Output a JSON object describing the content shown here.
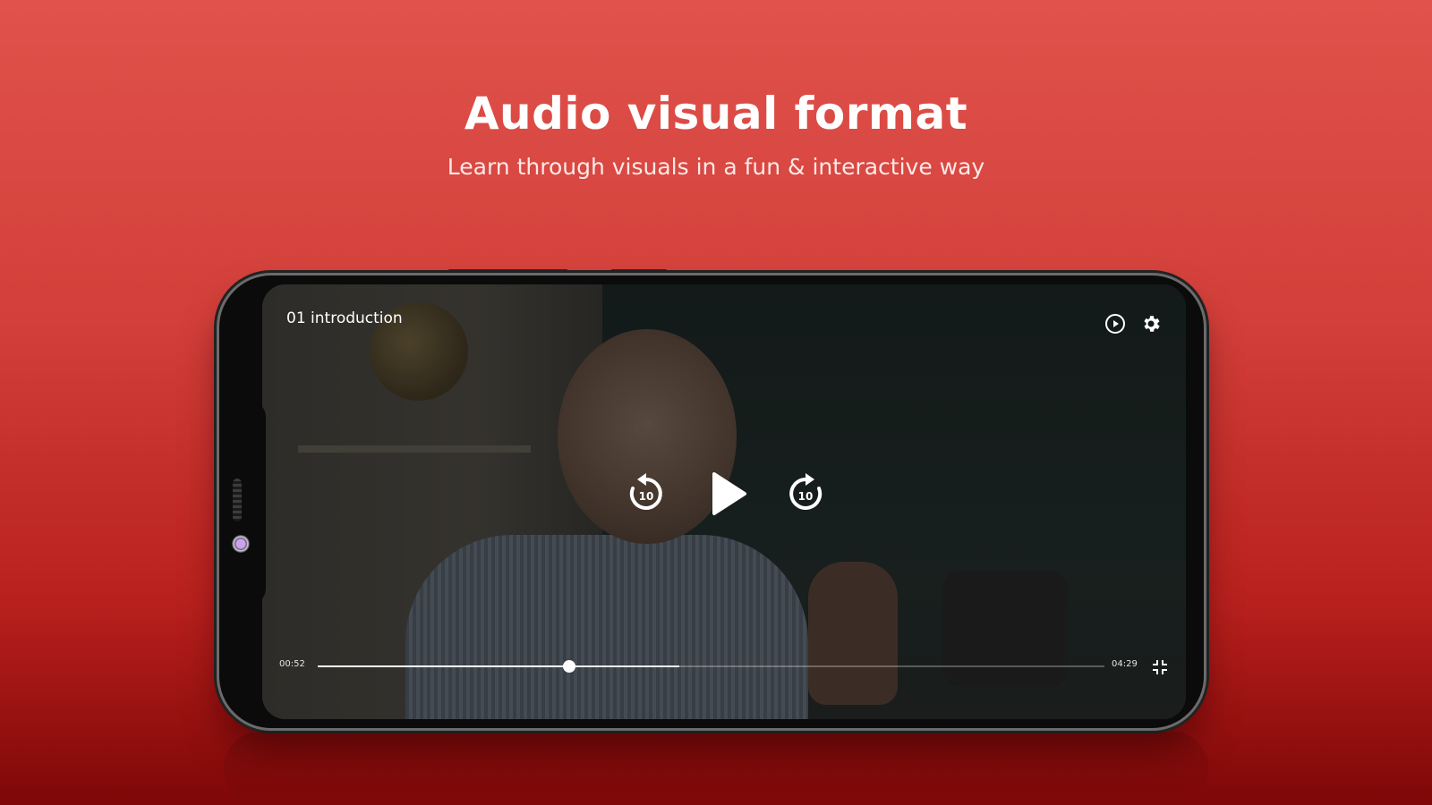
{
  "promo": {
    "headline": "Audio visual format",
    "subheadline": "Learn through visuals in a fun & interactive way"
  },
  "player": {
    "video_title": "01 introduction",
    "current_time": "00:52",
    "total_time": "04:29",
    "played_fraction": 0.32,
    "buffered_fraction": 0.46,
    "rewind_seconds": "10",
    "forward_seconds": "10",
    "icons": {
      "autoplay": "play-circle-icon",
      "settings": "gear-icon",
      "rewind": "rewind-10-icon",
      "play": "play-icon",
      "forward": "forward-10-icon",
      "fullscreen_exit": "fullscreen-exit-icon"
    }
  },
  "colors": {
    "background_top": "#e0524b",
    "background_bottom": "#7e0707",
    "control_white": "#ffffff"
  }
}
